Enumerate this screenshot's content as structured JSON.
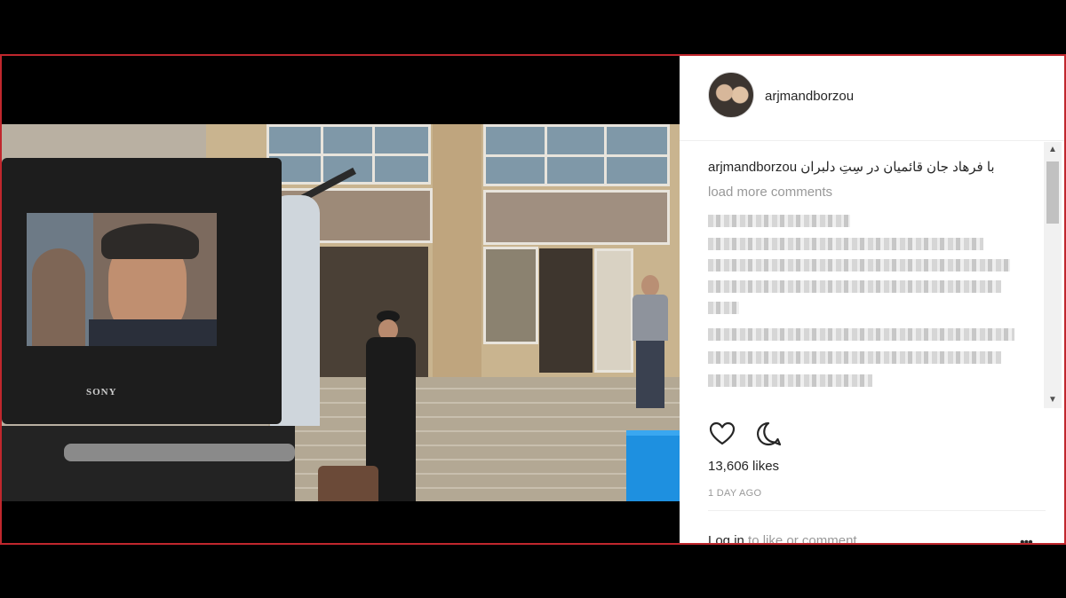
{
  "post": {
    "username": "arjmandborzou",
    "caption_user": "arjmandborzou",
    "caption_text": "با فرهاد جان قائمیان در سِتِ دلبران",
    "load_more": "load more comments",
    "likes": "13,606 likes",
    "timestamp": "1 DAY AGO",
    "login_link": "Log in",
    "login_rest": " to like or comment.",
    "more_options": "•••"
  },
  "photo": {
    "monitor_brand": "SONY"
  },
  "icons": {
    "like": "heart-icon",
    "comment": "comment-bubble-icon",
    "scroll_up": "▲",
    "scroll_down": "▼"
  },
  "colors": {
    "frame_border": "#c0272d",
    "text": "#262626",
    "muted": "#999999"
  }
}
